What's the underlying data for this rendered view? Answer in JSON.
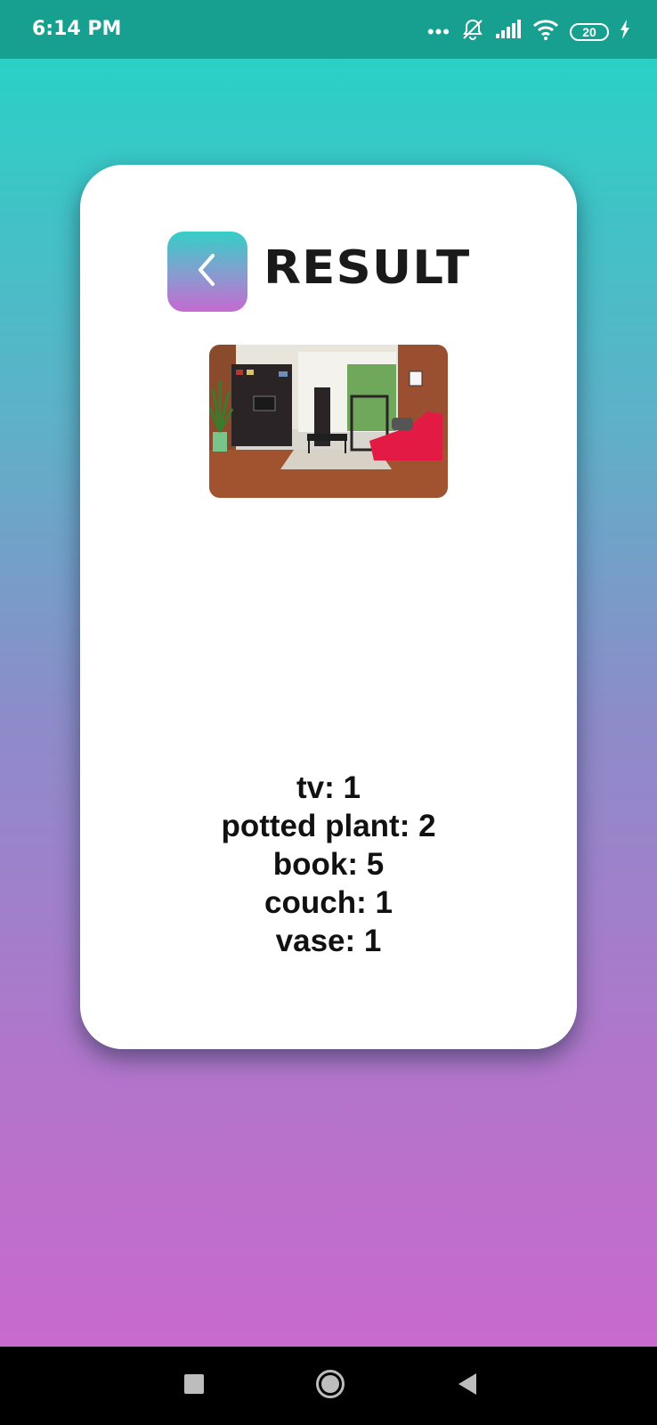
{
  "status_bar": {
    "time": "6:14 PM",
    "battery_level": "20",
    "icons": [
      "more-dots-icon",
      "bell-off-icon",
      "signal-icon",
      "wifi-icon",
      "battery-icon",
      "charging-icon"
    ]
  },
  "header": {
    "title": "RESULT",
    "back_icon": "chevron-left-icon"
  },
  "results": [
    "tv: 1",
    "potted plant: 2",
    "book: 5",
    "couch: 1",
    "vase: 1"
  ],
  "nav_bar": {
    "icons": [
      "recent-apps-icon",
      "home-icon",
      "back-icon"
    ]
  },
  "colors": {
    "status_bar": "#17a08f",
    "gradient_top": "#22d6c4",
    "gradient_bottom": "#cf66cf",
    "card": "#ffffff"
  }
}
